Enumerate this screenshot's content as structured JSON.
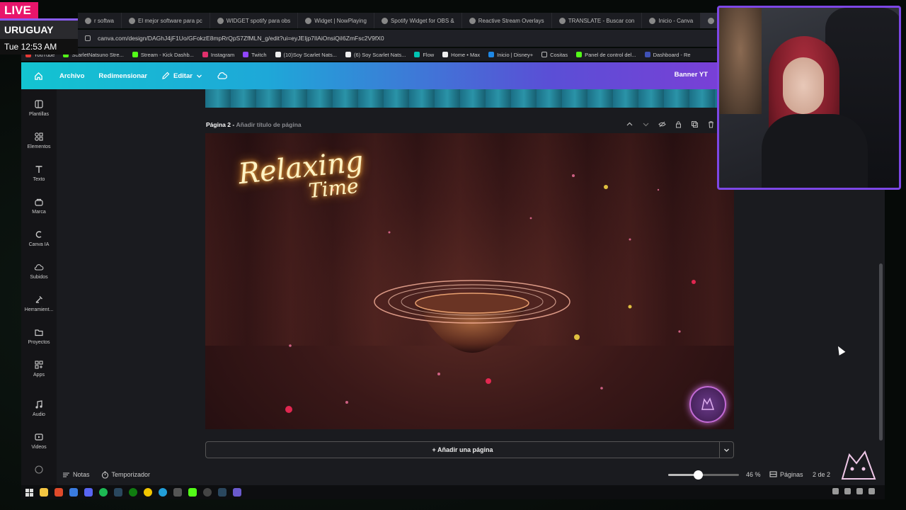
{
  "overlay": {
    "live": "LIVE",
    "country": "URUGUAY",
    "time": "Tue 12:53 AM"
  },
  "browser": {
    "tabs": [
      {
        "label": "r softwa",
        "active": false
      },
      {
        "label": "El mejor software para pc",
        "active": false
      },
      {
        "label": "WIDGET spotify para obs",
        "active": false
      },
      {
        "label": "Widget | NowPlaying",
        "active": false
      },
      {
        "label": "Spotify Widget for OBS &",
        "active": false
      },
      {
        "label": "Reactive Stream Overlays",
        "active": false
      },
      {
        "label": "TRANSLATE - Buscar con",
        "active": false
      },
      {
        "label": "Inicio - Canva",
        "active": false
      },
      {
        "label": "Ba",
        "active": true
      }
    ],
    "url": "canva.com/design/DAGhJ4jF1Uo/GFokzE8mpRrQpS7ZfMLN_g/edit?ui=eyJEIjp7IlAiOnsiQiI6ZmFsc2V9fX0",
    "bookmarks": [
      {
        "label": "YouTube",
        "color": "#e53935"
      },
      {
        "label": "ScarletNatsuno Stre...",
        "color": "#53fc18"
      },
      {
        "label": "Stream - Kick Dashb...",
        "color": "#53fc18"
      },
      {
        "label": "Instagram",
        "color": "#e1306c"
      },
      {
        "label": "Twitch",
        "color": "#9146ff"
      },
      {
        "label": "(10)Soy Scarlet Nats...",
        "color": "#eeeeee"
      },
      {
        "label": "(6) Soy Scarlet Nats...",
        "color": "#eeeeee"
      },
      {
        "label": "Flow",
        "color": "#00c4b3"
      },
      {
        "label": "Home • Max",
        "color": "#eeeeee"
      },
      {
        "label": "Inicio | Disney+",
        "color": "#1e88e5"
      },
      {
        "label": "Cositas",
        "color": "#bbbbbb"
      },
      {
        "label": "Panel de control del...",
        "color": "#53fc18"
      },
      {
        "label": "Dashboard - Re",
        "color": "#3f51b5"
      }
    ]
  },
  "canva": {
    "header": {
      "archivo": "Archivo",
      "redimensionar": "Redimensionar",
      "editar": "Editar",
      "banner": "Banner YT"
    },
    "sidebar": [
      {
        "label": "Plantillas",
        "icon": "templates-icon"
      },
      {
        "label": "Elementos",
        "icon": "elements-icon"
      },
      {
        "label": "Texto",
        "icon": "text-icon"
      },
      {
        "label": "Marca",
        "icon": "brand-icon"
      },
      {
        "label": "Canva IA",
        "icon": "canva-ai-icon"
      },
      {
        "label": "Subidos",
        "icon": "uploads-icon"
      },
      {
        "label": "Herramient...",
        "icon": "tools-icon"
      },
      {
        "label": "Proyectos",
        "icon": "projects-icon"
      },
      {
        "label": "Apps",
        "icon": "apps-icon"
      },
      {
        "label": "Audio",
        "icon": "audio-icon"
      },
      {
        "label": "Videos",
        "icon": "videos-icon"
      }
    ],
    "page2": {
      "title": "Página 2 -",
      "subtitle": "Añadir título de página",
      "design_text_1": "Relaxing",
      "design_text_2": "Time"
    },
    "add_page": "+ Añadir una página",
    "footer": {
      "notas": "Notas",
      "temporizador": "Temporizador",
      "zoom": "46 %",
      "zoom_level": 0.42,
      "paginas": "Páginas",
      "page_count": "2 de 2"
    }
  }
}
